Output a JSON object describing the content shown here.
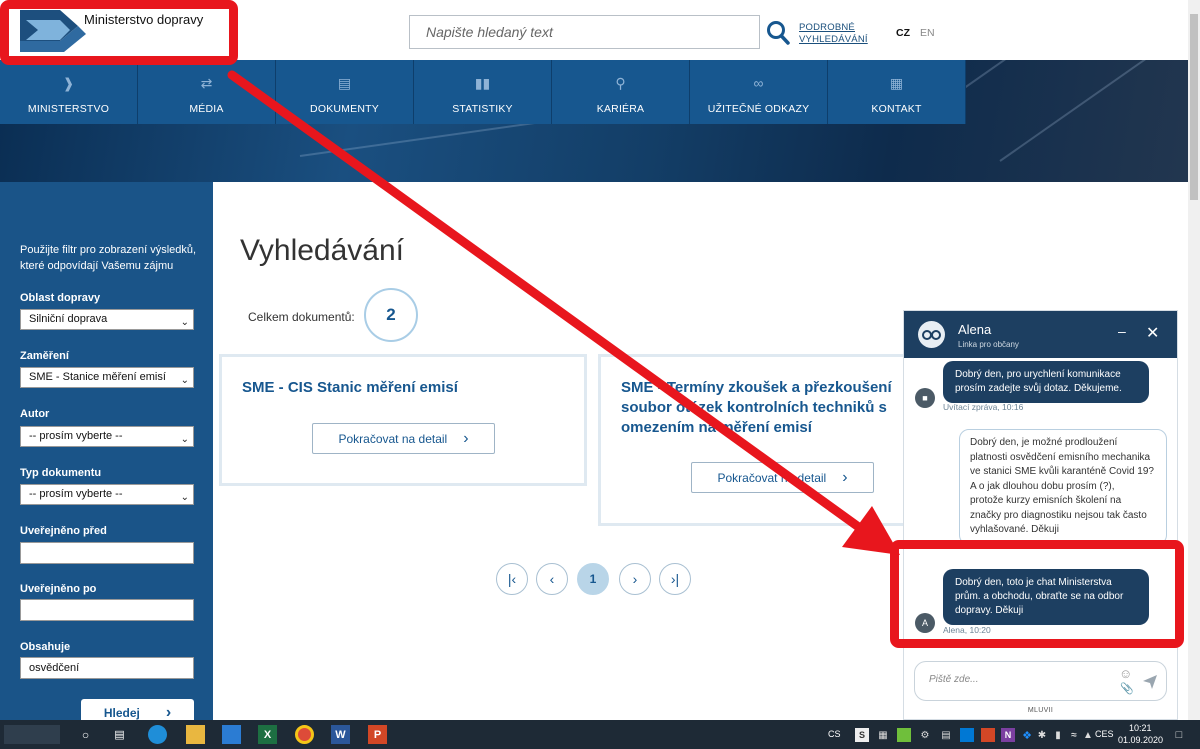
{
  "header": {
    "logo_text": "Ministerstvo dopravy",
    "search_placeholder": "Napište hledaný text",
    "advanced_search_line1": "PODROBNÉ",
    "advanced_search_line2": "VYHLEDÁVÁNÍ",
    "lang_cz": "CZ",
    "lang_en": "EN"
  },
  "nav": {
    "items": [
      {
        "label": "MINISTERSTVO",
        "icon": "arrow-logo-icon"
      },
      {
        "label": "MÉDIA",
        "icon": "shuffle-icon"
      },
      {
        "label": "DOKUMENTY",
        "icon": "document-icon"
      },
      {
        "label": "STATISTIKY",
        "icon": "bar-chart-icon"
      },
      {
        "label": "KARIÉRA",
        "icon": "search-person-icon"
      },
      {
        "label": "UŽITEČNÉ ODKAZY",
        "icon": "link-icon"
      },
      {
        "label": "KONTAKT",
        "icon": "contact-card-icon"
      }
    ]
  },
  "sidebar": {
    "intro": "Použijte filtr pro zobrazení výsledků, které odpovídají Vašemu zájmu",
    "oblast_label": "Oblast dopravy",
    "oblast_value": "Silniční doprava",
    "zamereni_label": "Zaměření",
    "zamereni_value": "SME - Stanice měření emisí",
    "autor_label": "Autor",
    "autor_value": "-- prosím vyberte --",
    "typ_label": "Typ dokumentu",
    "typ_value": "-- prosím vyberte --",
    "pred_label": "Uveřejněno před",
    "pred_value": "",
    "po_label": "Uveřejněno po",
    "po_value": "",
    "obsahuje_label": "Obsahuje",
    "obsahuje_value": "osvědčení",
    "search_button": "Hledej"
  },
  "main": {
    "title": "Vyhledávání",
    "count_label": "Celkem dokumentů:",
    "count_value": "2",
    "cards": [
      {
        "title_lines": [
          "SME - CIS Stanic měření emisí"
        ],
        "button": "Pokračovat na detail"
      },
      {
        "title_lines": [
          "SME - Termíny zkoušek a přezkoušení",
          "soubor otázek kontrolních techniků s",
          "omezením na měření emisí"
        ],
        "button": "Pokračovat na detail"
      }
    ],
    "pagination": {
      "current": "1"
    }
  },
  "chat": {
    "agent_name": "Alena",
    "agent_subtitle": "Linka pro občany",
    "messages": [
      {
        "from": "agent",
        "text_lines": [
          "Dobrý den, pro urychlení komunikace",
          "prosím zadejte svůj dotaz. Děkujeme."
        ],
        "meta": "Uvítací zpráva, 10:16"
      },
      {
        "from": "user",
        "text_lines": [
          "Dobrý den, je možné prodloužení",
          "platnosti osvědčení emisního mechanika",
          "ve stanici SME kvůli karanténě Covid 19?",
          "A o jak dlouhou dobu prosím (?),",
          "protože kurzy emisních školení na",
          "značky pro diagnostiku nejsou tak často",
          "vyhlašované. Děkuji"
        ]
      },
      {
        "from": "agent",
        "text_lines": [
          "Dobrý den, toto je chat Ministerstva",
          "prům. a obchodu, obraťte se na odbor",
          "dopravy. Děkuji"
        ],
        "meta": "Alena, 10:20",
        "avatar_letter": "A"
      }
    ],
    "input_placeholder": "Piště zde...",
    "footer": "MLUVII"
  },
  "taskbar": {
    "lang_short": "CS",
    "lang_input": "CES",
    "time": "10:21",
    "date": "01.09.2020"
  },
  "colors": {
    "brand_blue": "#17578f",
    "sidebar_blue": "#1a5488",
    "chat_navy": "#1d3f61",
    "annotation_red": "#e8161d"
  }
}
